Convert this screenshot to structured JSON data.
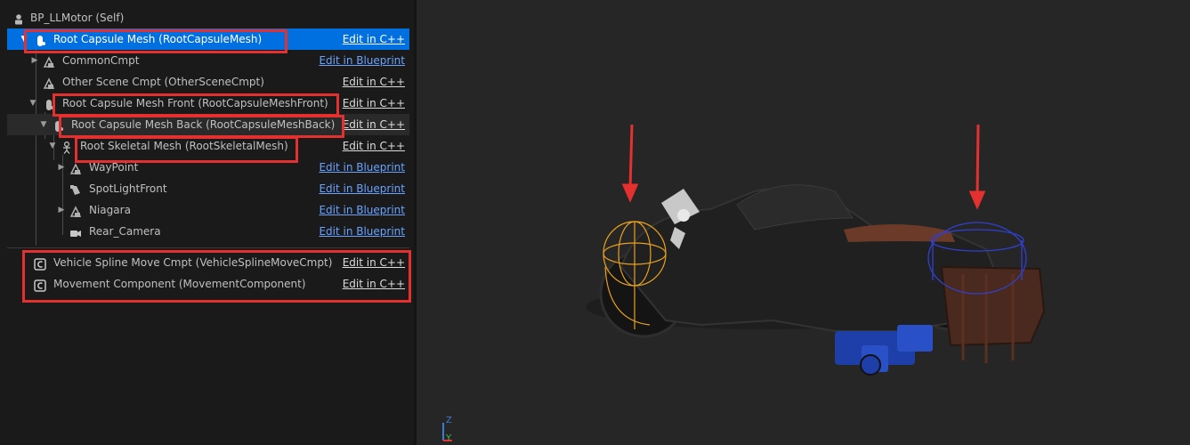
{
  "components": {
    "root": {
      "label": "BP_LLMotor (Self)",
      "icon": "actor-icon"
    },
    "items": [
      {
        "label": "Root Capsule Mesh (RootCapsuleMesh)",
        "action": "Edit in C++",
        "action_type": "cpp",
        "icon": "capsule-mesh-icon",
        "selected": true
      },
      {
        "label": "CommonCmpt",
        "action": "Edit in Blueprint",
        "action_type": "blueprint",
        "icon": "scene-component-icon"
      },
      {
        "label": "Other Scene Cmpt (OtherSceneCmpt)",
        "action": "Edit in C++",
        "action_type": "cpp",
        "icon": "scene-component-icon"
      },
      {
        "label": "Root Capsule Mesh Front (RootCapsuleMeshFront)",
        "action": "Edit in C++",
        "action_type": "cpp",
        "icon": "capsule-mesh-icon"
      },
      {
        "label": "Root Capsule Mesh Back (RootCapsuleMeshBack)",
        "action": "Edit in C++",
        "action_type": "cpp",
        "icon": "capsule-mesh-icon"
      },
      {
        "label": "Root Skeletal Mesh (RootSkeletalMesh)",
        "action": "Edit in C++",
        "action_type": "cpp",
        "icon": "skeletal-mesh-icon"
      },
      {
        "label": "WayPoint",
        "action": "Edit in Blueprint",
        "action_type": "blueprint",
        "icon": "scene-component-icon"
      },
      {
        "label": "SpotLightFront",
        "action": "Edit in Blueprint",
        "action_type": "blueprint",
        "icon": "spot-light-icon"
      },
      {
        "label": "Niagara",
        "action": "Edit in Blueprint",
        "action_type": "blueprint",
        "icon": "scene-component-icon"
      },
      {
        "label": "Rear_Camera",
        "action": "Edit in Blueprint",
        "action_type": "blueprint",
        "icon": "camera-icon"
      }
    ],
    "actor_components": [
      {
        "label": "Vehicle Spline Move Cmpt (VehicleSplineMoveCmpt)",
        "action": "Edit in C++",
        "action_type": "cpp",
        "icon": "cpp-component-icon"
      },
      {
        "label": "Movement Component (MovementComponent)",
        "action": "Edit in C++",
        "action_type": "cpp",
        "icon": "cpp-component-icon"
      }
    ]
  },
  "viewport": {
    "axis_y_label": "Y",
    "axis_z_label": "Z"
  },
  "colors": {
    "selection": "#0070e0",
    "highlight": "#e53030",
    "blueprint_link": "#6aa3ff",
    "viewport_bg": "#262626",
    "capsule_front": "#e8a020",
    "capsule_back": "#3040d0"
  }
}
